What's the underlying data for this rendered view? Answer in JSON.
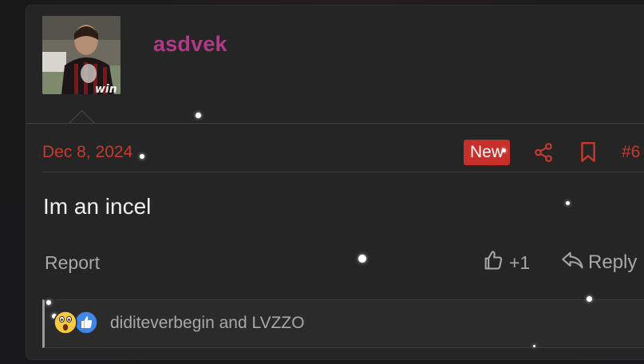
{
  "post": {
    "username": "asdvek",
    "date": "Dec 8, 2024",
    "badge": "New",
    "post_number": "#6",
    "body": "Im an incel",
    "actions": {
      "report_label": "Report",
      "like_count": "+1",
      "reply_label": "Reply"
    },
    "reactions": {
      "users_text": "diditeverbegin and LVZZO",
      "icons": [
        "wow-emoji-icon",
        "like-thumb-icon"
      ]
    }
  },
  "icons": {
    "share": "share-icon",
    "bookmark": "bookmark-icon",
    "like": "thumbs-up-icon",
    "reply": "reply-arrow-icon"
  },
  "colors": {
    "username": "#b13a87",
    "accent": "#c63a2f",
    "badge_bg": "#c82f2a",
    "muted_text": "#a8a8a8",
    "panel_bg": "#252526"
  }
}
